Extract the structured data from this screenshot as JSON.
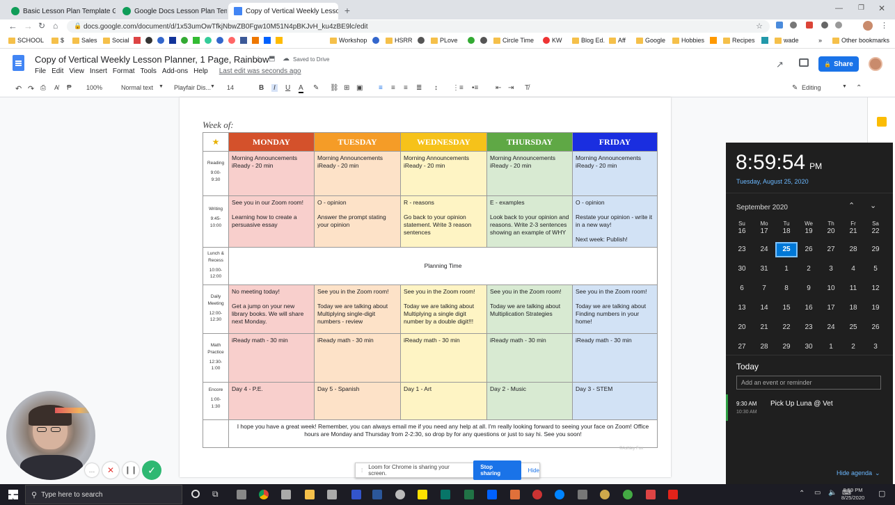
{
  "tabs": [
    {
      "title": "Basic Lesson Plan Template Goo",
      "icon_color": "#0f9d58"
    },
    {
      "title": "Google Docs Lesson Plan Templa",
      "icon_color": "#0f9d58"
    },
    {
      "title": "Copy of Vertical Weekly Lesso",
      "icon_color": "#4285f4",
      "active": true
    }
  ],
  "address": {
    "url": "docs.google.com/document/d/1x53umOwTfkjNbwZB0Fgw10M51N4pBKJvH_ku4zBE9lc/edit"
  },
  "bookmarks": [
    "SCHOOL",
    "$",
    "Sales",
    "Social",
    "Workshop",
    "HSRR",
    "PLove",
    "Circle Time",
    "KW",
    "Blog Ed.",
    "Aff",
    "Google",
    "Hobbies",
    "Recipes",
    "wade",
    "Other bookmarks"
  ],
  "doc": {
    "title": "Copy of Vertical Weekly Lesson Planner, 1 Page, Rainbow",
    "saved": "Saved to Drive",
    "menus": [
      "File",
      "Edit",
      "View",
      "Insert",
      "Format",
      "Tools",
      "Add-ons",
      "Help"
    ],
    "last_edit": "Last edit was seconds ago",
    "share_label": "Share"
  },
  "toolbar": {
    "zoom": "100%",
    "style": "Normal text",
    "font": "Playfair Dis...",
    "size": "14",
    "mode": "Editing"
  },
  "planner": {
    "week_of": "Week of:",
    "star": "★",
    "days": [
      "MONDAY",
      "TUESDAY",
      "WEDNESDAY",
      "THURSDAY",
      "FRIDAY"
    ],
    "day_colors": [
      "#d4512b",
      "#f59c27",
      "#f6c21a",
      "#5fa845",
      "#1a2ee0"
    ],
    "rows": [
      {
        "label": "Reading",
        "time": "9:00-\n9:30",
        "cells": [
          "Morning Announcements\niReady - 20 min",
          "Morning Announcements\niReady - 20 min",
          "Morning Announcements\niReady - 20 min",
          "Morning Announcements\niReady - 20 min",
          "Morning Announcements\niReady - 20 min"
        ]
      },
      {
        "label": "Writing",
        "time": "9:45-\n10:00",
        "cells": [
          "See you in our Zoom room!\n\nLearning how to create a persuasive essay",
          "O - opinion\n\nAnswer the prompt stating your opinion",
          "R - reasons\n\nGo back to your opinion statement. Write 3 reason sentences",
          "E - examples\n\nLook back to your opinion and reasons. Write 2-3 sentences showing an example of WHY",
          "O - opinion\n\nRestate your opinion - write it in a new way!\n\nNext week: Publish!"
        ]
      },
      {
        "label": "Lunch &\nRecess",
        "time": "10:00-\n12:00",
        "merged": "Planning Time"
      },
      {
        "label": "Daily\nMeeting",
        "time": "12:00-\n12:30",
        "cells": [
          "No meeting today!\n\nGet a jump on your new library books. We will share next Monday.",
          "See  you in the Zoom room!\n\nToday we are talking about Multiplying single-digit numbers - review",
          "See  you in the Zoom room!\n\nToday we are talking about Multiplying a single digit number by a double digit!!!",
          "See  you in the Zoom room!\n\nToday we are talking about Multiplication Strategies",
          "See  you in the Zoom room!\n\nToday we are talking about Finding numbers in your home!"
        ]
      },
      {
        "label": "Math\nPractice",
        "time": "12:30-\n1:00",
        "cells": [
          "iReady math - 30 min",
          "iReady math - 30 min",
          "iReady math - 30 min",
          "iReady math - 30 min",
          "iReady math - 30 min"
        ]
      },
      {
        "label": "Encore",
        "time": "1:00-\n1:30",
        "cells": [
          "Day 4 - P.E.",
          "Day 5 - Spanish",
          "Day 1 - Art",
          "Day 2 - Music",
          "Day 3 - STEM"
        ]
      }
    ],
    "footer": "I hope you have a great week! Remember, you can always email me if you need any help at all. I'm really looking forward to seeing your face on Zoom! Office hours are Monday and Thursday from 2-2:30, so drop by for any questions or just to say hi. See you soon!",
    "watermark": "©Ashley Fox"
  },
  "clock": {
    "time": "8:59:54",
    "ampm": "PM",
    "date": "Tuesday, August 25, 2020",
    "month": "September 2020",
    "weekdays": [
      "Su",
      "Mo",
      "Tu",
      "We",
      "Th",
      "Fr",
      "Sa"
    ],
    "weeks": [
      [
        "16",
        "17",
        "18",
        "19",
        "20",
        "21",
        "22"
      ],
      [
        "23",
        "24",
        "25",
        "26",
        "27",
        "28",
        "29"
      ],
      [
        "30",
        "31",
        "1",
        "2",
        "3",
        "4",
        "5"
      ],
      [
        "6",
        "7",
        "8",
        "9",
        "10",
        "11",
        "12"
      ],
      [
        "13",
        "14",
        "15",
        "16",
        "17",
        "18",
        "19"
      ],
      [
        "20",
        "21",
        "22",
        "23",
        "24",
        "25",
        "26"
      ],
      [
        "27",
        "28",
        "29",
        "30",
        "1",
        "2",
        "3"
      ]
    ],
    "today_label": "Today",
    "add_event_placeholder": "Add an event or reminder",
    "event": {
      "start": "9:30 AM",
      "end": "10:30 AM",
      "title": "Pick Up Luna @ Vet"
    },
    "hide_agenda": "Hide agenda"
  },
  "share_bar": {
    "text": "Loom for Chrome is sharing your screen.",
    "stop": "Stop sharing",
    "hide": "Hide"
  },
  "taskbar": {
    "search_placeholder": "Type here to search",
    "time": "8:59 PM",
    "date": "8/25/2020"
  }
}
